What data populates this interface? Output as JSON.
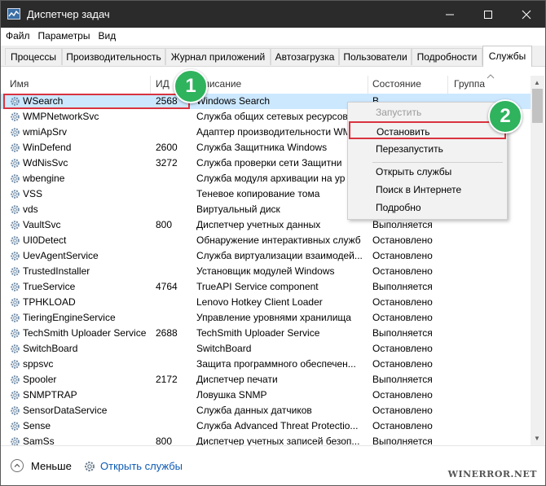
{
  "window": {
    "title": "Диспетчер задач"
  },
  "menu": [
    "Файл",
    "Параметры",
    "Вид"
  ],
  "tabs": [
    "Процессы",
    "Производительность",
    "Журнал приложений",
    "Автозагрузка",
    "Пользователи",
    "Подробности",
    "Службы"
  ],
  "active_tab": "Службы",
  "columns": {
    "name": "Имя",
    "pid": "ИД",
    "description": "Описание",
    "status": "Состояние",
    "group": "Группа"
  },
  "services": [
    {
      "name": "WSearch",
      "pid": "2568",
      "description": "Windows Search",
      "status": "В"
    },
    {
      "name": "WMPNetworkSvc",
      "pid": "",
      "description": "Служба общих сетевых ресурсов",
      "status": ""
    },
    {
      "name": "wmiApSrv",
      "pid": "",
      "description": "Адаптер производительности WM",
      "status": ""
    },
    {
      "name": "WinDefend",
      "pid": "2600",
      "description": "Служба Защитника Windows",
      "status": ""
    },
    {
      "name": "WdNisSvc",
      "pid": "3272",
      "description": "Служба проверки сети Защитни",
      "status": ""
    },
    {
      "name": "wbengine",
      "pid": "",
      "description": "Служба модуля архивации на ур",
      "status": ""
    },
    {
      "name": "VSS",
      "pid": "",
      "description": "Теневое копирование тома",
      "status": ""
    },
    {
      "name": "vds",
      "pid": "",
      "description": "Виртуальный диск",
      "status": ""
    },
    {
      "name": "VaultSvc",
      "pid": "800",
      "description": "Диспетчер учетных данных",
      "status": "Выполняется"
    },
    {
      "name": "UI0Detect",
      "pid": "",
      "description": "Обнаружение интерактивных служб",
      "status": "Остановлено"
    },
    {
      "name": "UevAgentService",
      "pid": "",
      "description": "Служба виртуализации взаимодей...",
      "status": "Остановлено"
    },
    {
      "name": "TrustedInstaller",
      "pid": "",
      "description": "Установщик модулей Windows",
      "status": "Остановлено"
    },
    {
      "name": "TrueService",
      "pid": "4764",
      "description": "TrueAPI Service component",
      "status": "Выполняется"
    },
    {
      "name": "TPHKLOAD",
      "pid": "",
      "description": "Lenovo Hotkey Client Loader",
      "status": "Остановлено"
    },
    {
      "name": "TieringEngineService",
      "pid": "",
      "description": "Управление уровнями хранилища",
      "status": "Остановлено"
    },
    {
      "name": "TechSmith Uploader Service",
      "pid": "2688",
      "description": "TechSmith Uploader Service",
      "status": "Выполняется"
    },
    {
      "name": "SwitchBoard",
      "pid": "",
      "description": "SwitchBoard",
      "status": "Остановлено"
    },
    {
      "name": "sppsvc",
      "pid": "",
      "description": "Защита программного обеспечен...",
      "status": "Остановлено"
    },
    {
      "name": "Spooler",
      "pid": "2172",
      "description": "Диспетчер печати",
      "status": "Выполняется"
    },
    {
      "name": "SNMPTRAP",
      "pid": "",
      "description": "Ловушка SNMP",
      "status": "Остановлено"
    },
    {
      "name": "SensorDataService",
      "pid": "",
      "description": "Служба данных датчиков",
      "status": "Остановлено"
    },
    {
      "name": "Sense",
      "pid": "",
      "description": "Служба Advanced Threat Protectio...",
      "status": "Остановлено"
    },
    {
      "name": "SamSs",
      "pid": "800",
      "description": "Диспетчер учетных записей безоп...",
      "status": "Выполняется"
    }
  ],
  "selected_service": "WSearch",
  "context_menu": {
    "items": [
      "Запустить",
      "Остановить",
      "Перезапустить",
      "Открыть службы",
      "Поиск в Интернете",
      "Подробно"
    ],
    "disabled": [
      "Запустить"
    ],
    "highlighted": "Остановить"
  },
  "badges": [
    "1",
    "2"
  ],
  "footer": {
    "less_label": "Меньше",
    "open_services_label": "Открыть службы"
  },
  "watermark": "WINERROR.NET",
  "colors": {
    "titlebar": "#2b2b2b",
    "selection": "#cce8ff",
    "highlight": "#d9333f",
    "badge": "#2fb35d",
    "link": "#0d5ab4"
  }
}
